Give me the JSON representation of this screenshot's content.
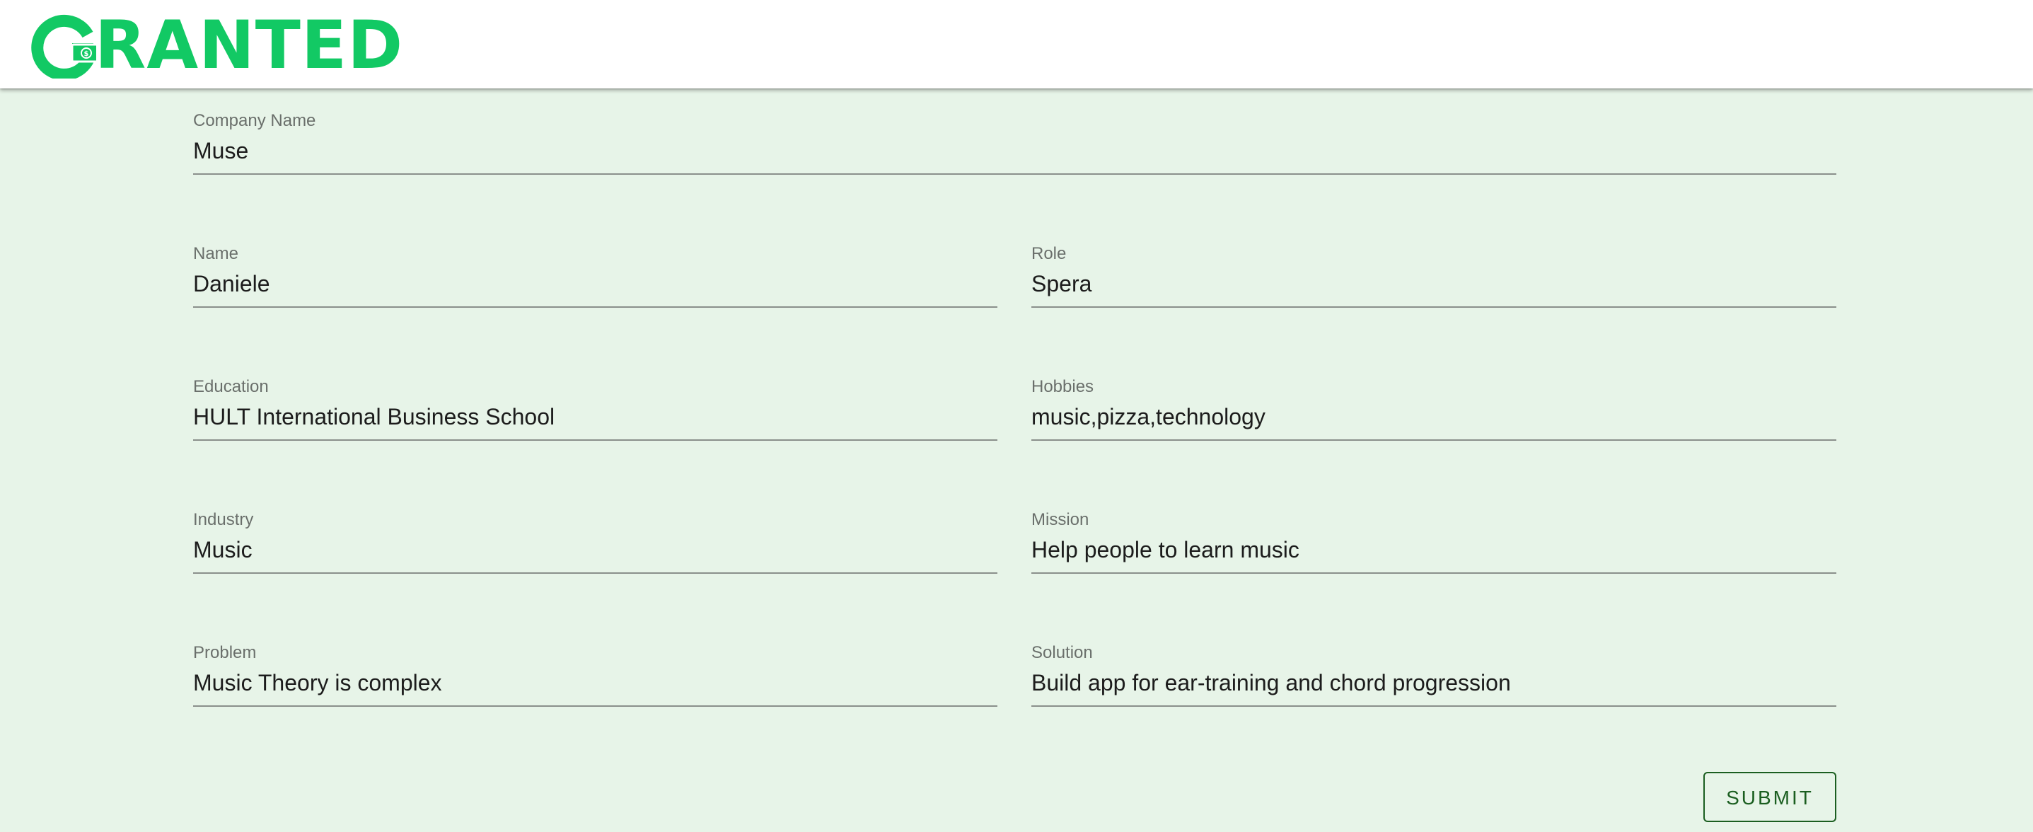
{
  "brand": {
    "logo_text": "GRANTED",
    "logo_rest": "RANTED",
    "color": "#12c964"
  },
  "form": {
    "company_name": {
      "label": "Company Name",
      "value": "Muse"
    },
    "name": {
      "label": "Name",
      "value": "Daniele"
    },
    "role": {
      "label": "Role",
      "value": "Spera"
    },
    "education": {
      "label": "Education",
      "value": "HULT International Business School"
    },
    "hobbies": {
      "label": "Hobbies",
      "value": "music,pizza,technology"
    },
    "industry": {
      "label": "Industry",
      "value": "Music"
    },
    "mission": {
      "label": "Mission",
      "value": "Help people to learn music"
    },
    "problem": {
      "label": "Problem",
      "value": "Music Theory is complex"
    },
    "solution": {
      "label": "Solution",
      "value": "Build app for ear-training and chord progression"
    }
  },
  "submit": {
    "label": "SUBMIT"
  },
  "colors": {
    "background": "#e7f4e8",
    "accent": "#1b5e20"
  }
}
